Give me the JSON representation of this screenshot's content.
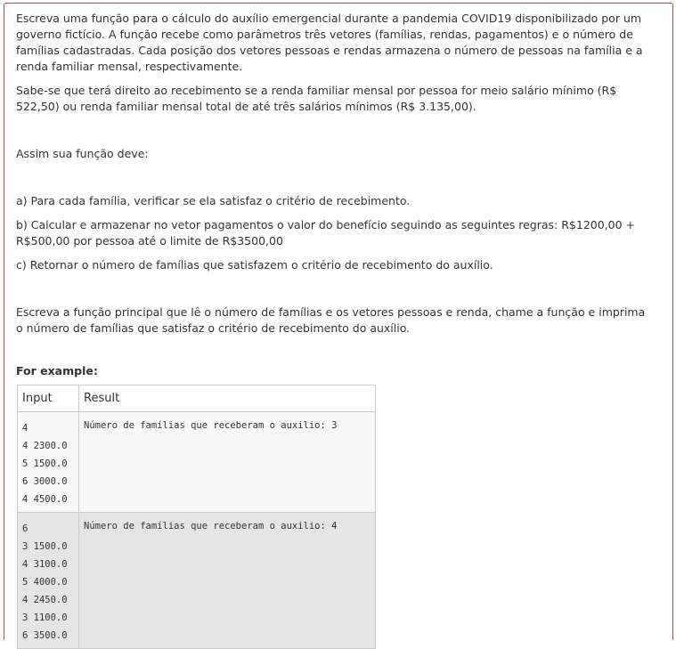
{
  "question": {
    "paragraphs": [
      "Escreva uma função para o cálculo do auxílio emergencial durante a pandemia COVID19 disponibilizado por um governo fictício. A função recebe como parâmetros três vetores (famílias, rendas, pagamentos) e o número de famílias cadastradas. Cada posição dos vetores pessoas e rendas armazena o número de pessoas na família e a renda familiar mensal, respectivamente.",
      "Sabe-se que terá direito ao recebimento se a renda familiar mensal por pessoa for meio salário mínimo (R$ 522,50) ou renda familiar mensal total de até três salários mínimos (R$ 3.135,00).",
      "Assim sua função deve:",
      "a) Para cada família, verificar se ela satisfaz o critério de recebimento.",
      "b) Calcular e armazenar no vetor pagamentos o valor do benefício seguindo as seguintes regras: R$1200,00 + R$500,00 por pessoa até o limite de R$3500,00",
      "c) Retornar o número de famílias que satisfazem o critério de recebimento do auxílio.",
      "Escreva a função principal que lê o número de famílias e os vetores pessoas e renda, chame a função e imprima o número de famílias que satisfaz o critério de recebimento do auxílio."
    ]
  },
  "example": {
    "label": "For example:",
    "headers": {
      "input": "Input",
      "result": "Result"
    },
    "rows": [
      {
        "input": [
          "4",
          "4 2300.0",
          "5 1500.0",
          "6 3000.0",
          "4 4500.0"
        ],
        "result": "Número de famílias que receberam o auxilio: 3"
      },
      {
        "input": [
          "6",
          "3 1500.0",
          "4 3100.0",
          "5 4000.0",
          "4 2450.0",
          "3 1100.0",
          "6 3500.0"
        ],
        "result": "Número de famílias que receberam o auxilio: 4"
      }
    ]
  }
}
